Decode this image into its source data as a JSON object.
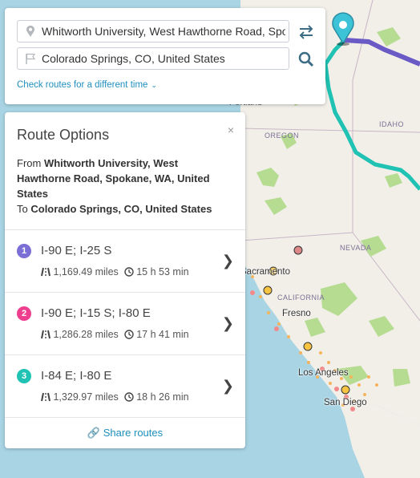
{
  "search": {
    "origin_value": "Whitworth University, West Hawthorne Road, Spo",
    "destination_value": "Colorado Springs, CO, United States",
    "different_time_label": "Check routes for a different time",
    "pin_icon": "map-pin-icon",
    "flag_icon": "flag-icon",
    "swap_icon": "swap-arrows-icon",
    "search_icon": "search-icon"
  },
  "route_options": {
    "title": "Route Options",
    "close_label": "×",
    "from_label": "From",
    "from_value": "Whitworth University, West Hawthorne Road, Spokane, WA, United States",
    "to_label": "To",
    "to_value": "Colorado Springs, CO, United States",
    "routes": [
      {
        "num": "1",
        "name": "I-90 E; I-25 S",
        "distance": "1,169.49 miles",
        "time": "15 h 53 min",
        "color": "#7b6fd6"
      },
      {
        "num": "2",
        "name": "I-90 E; I-15 S; I-80 E",
        "distance": "1,286.28 miles",
        "time": "17 h 41 min",
        "color": "#ee3f8f"
      },
      {
        "num": "3",
        "name": "I-84 E; I-80 E",
        "distance": "1,329.97 miles",
        "time": "18 h 26 min",
        "color": "#1fc2b3"
      }
    ],
    "share_label": "Share routes"
  },
  "map": {
    "labels": {
      "portland": "Portland",
      "oregon": "OREGON",
      "idaho": "IDAHO",
      "nevada": "NEVADA",
      "california": "CALIFORNIA",
      "sacramento": "Sacramento",
      "fresno": "Fresno",
      "los_angeles": "Los Angeles",
      "san_diego": "San Diego"
    },
    "colors": {
      "water": "#a9d4e4",
      "land": "#f2efe9",
      "parks": "#b5dc90",
      "route_teal": "#1fc2b3",
      "route_purple": "#6a5ac6"
    }
  }
}
